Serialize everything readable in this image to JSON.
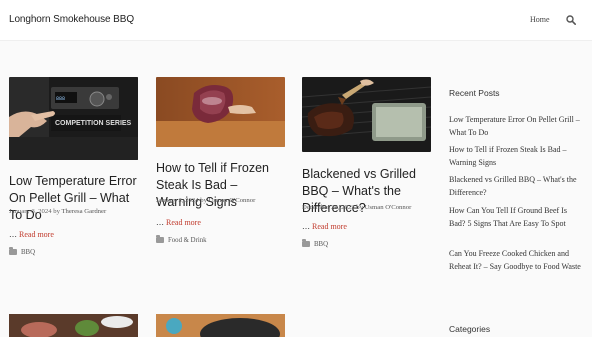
{
  "site": {
    "title": "Longhorn Smokehouse BBQ"
  },
  "nav": {
    "home_label": "Home",
    "search_icon": "search-icon"
  },
  "posts": [
    {
      "title": "Low Temperature Error On Pellet Grill – What To Do",
      "date": "January 3, 2024",
      "by": "by",
      "author": "Theresa Gardner",
      "read_more_prefix": "…",
      "read_more": "Read more",
      "category": "BBQ",
      "thumb_text": "COMPETITION SERIES"
    },
    {
      "title": "How to Tell if Frozen Steak Is Bad – Warning Signs",
      "date": "January 2, 2024",
      "by": "by",
      "author": "Usman O'Connor",
      "read_more_prefix": "…",
      "read_more": "Read more",
      "category": "Food & Drink"
    },
    {
      "title": "Blackened vs Grilled BBQ – What's the Difference?",
      "date": "December 29, 2023",
      "by": "by",
      "author": "Usman O'Connor",
      "read_more_prefix": "…",
      "read_more": "Read more",
      "category": "BBQ"
    }
  ],
  "sidebar": {
    "recent_title": "Recent Posts",
    "recent_posts": [
      "Low Temperature Error On Pellet Grill – What To Do",
      "How to Tell if Frozen Steak Is Bad – Warning Signs",
      "Blackened vs Grilled BBQ – What's the Difference?",
      "How Can You Tell If Ground Beef Is Bad? 5 Signs That Are Easy To Spot",
      "Can You Freeze Cooked Chicken and Reheat It? – Say Goodbye to Food Waste"
    ],
    "categories_title": "Categories"
  },
  "colors": {
    "link_accent": "#c0392b",
    "text": "#222222",
    "meta": "#666666"
  }
}
